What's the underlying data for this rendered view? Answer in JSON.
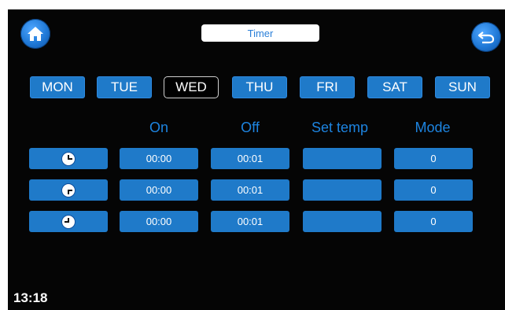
{
  "header": {
    "title": "Timer",
    "home_icon": "home-icon",
    "back_icon": "back-arrow-icon"
  },
  "days": [
    "MON",
    "TUE",
    "WED",
    "THU",
    "FRI",
    "SAT",
    "SUN"
  ],
  "selected_day": "WED",
  "columns": {
    "on": "On",
    "off": "Off",
    "set_temp": "Set temp",
    "mode": "Mode"
  },
  "rows": [
    {
      "clock_icon": "clock-icon",
      "on": "00:00",
      "off": "00:01",
      "set_temp": "",
      "mode": "0"
    },
    {
      "clock_icon": "clock-icon",
      "on": "00:00",
      "off": "00:01",
      "set_temp": "",
      "mode": "0"
    },
    {
      "clock_icon": "clock-icon",
      "on": "00:00",
      "off": "00:01",
      "set_temp": "",
      "mode": "0"
    }
  ],
  "status": {
    "time": "13:18"
  },
  "colors": {
    "background": "#050505",
    "accent": "#1f7ac9",
    "header_text": "#1d84e0"
  }
}
